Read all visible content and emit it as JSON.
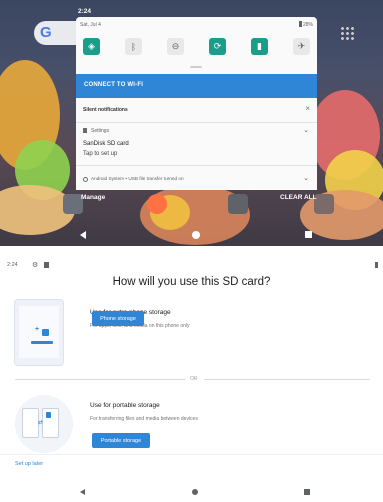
{
  "top": {
    "status_time": "2:24",
    "date": "Sat, Jul 4",
    "battery": "28%",
    "quick_tiles": [
      {
        "icon": "wifi-icon",
        "glyph": "◈",
        "state": "on"
      },
      {
        "icon": "bluetooth-icon",
        "glyph": "ᛒ",
        "state": "off"
      },
      {
        "icon": "do-not-disturb-icon",
        "glyph": "⊖",
        "state": "off"
      },
      {
        "icon": "auto-rotate-icon",
        "glyph": "⟳",
        "state": "on"
      },
      {
        "icon": "battery-saver-icon",
        "glyph": "▮",
        "state": "on"
      },
      {
        "icon": "airplane-mode-icon",
        "glyph": "✈",
        "state": "off"
      }
    ],
    "wifi_banner": "CONNECT TO WI-FI",
    "silent_header": "Silent notifications",
    "notification": {
      "app": "Settings",
      "title": "SanDisk SD card",
      "subtitle": "Tap to set up"
    },
    "android_system": "Android System • USB file transfer turned on",
    "manage_label": "Manage",
    "clear_all_label": "CLEAR ALL",
    "colors": {
      "accent": "#2f86d6",
      "tile_on": "#1a9e8a"
    }
  },
  "bottom": {
    "status_time": "2:24",
    "heading": "How will you use this SD card?",
    "option1": {
      "title": "Use for extra phone storage",
      "subtitle": "For apps, files, and media on this phone only",
      "button": "Phone storage"
    },
    "or_label": "OR",
    "option2": {
      "title": "Use for portable storage",
      "subtitle": "For transferring files and media between devices",
      "button": "Portable storage"
    },
    "setup_later": "Set up later"
  }
}
